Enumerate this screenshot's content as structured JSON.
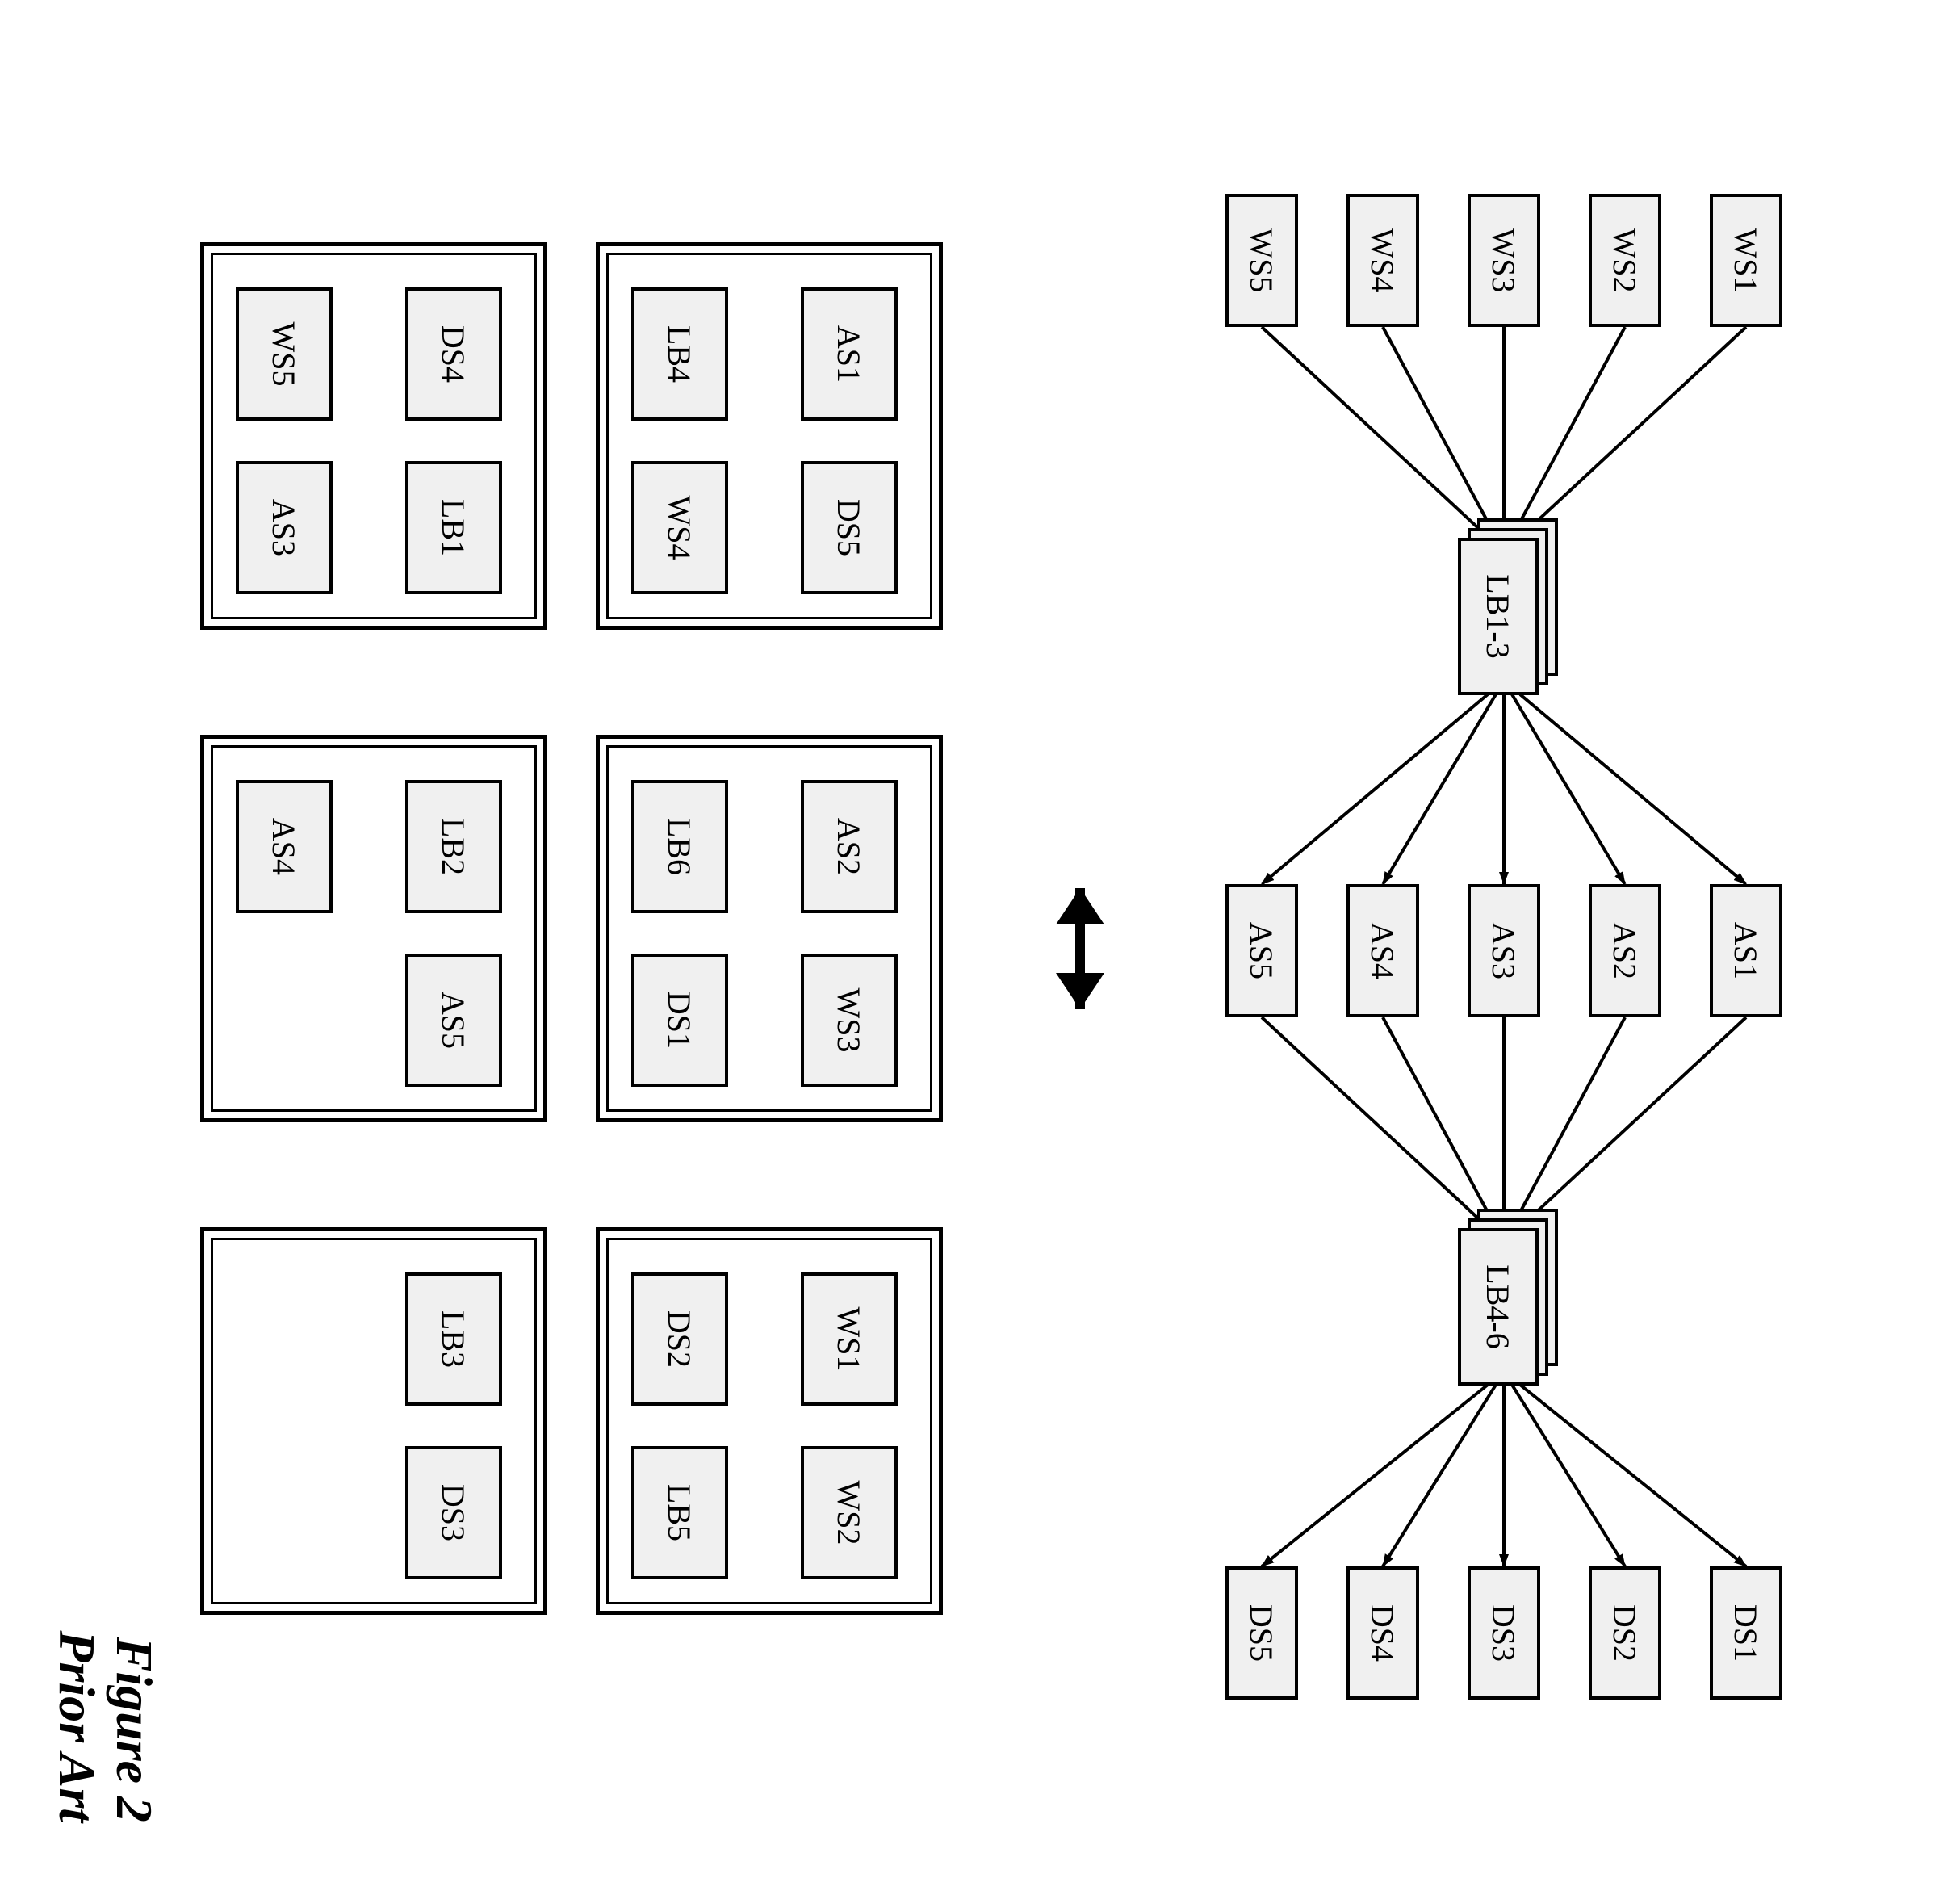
{
  "figure": {
    "number_label": "Figure 2",
    "subtitle": "Prior Art"
  },
  "network": {
    "ws": [
      "WS1",
      "WS2",
      "WS3",
      "WS4",
      "WS5"
    ],
    "lb_first": "LB1-3",
    "as": [
      "AS1",
      "AS2",
      "AS3",
      "AS4",
      "AS5"
    ],
    "lb_second": "LB4-6",
    "ds": [
      "DS1",
      "DS2",
      "DS3",
      "DS4",
      "DS5"
    ]
  },
  "hosts": [
    {
      "slots": [
        "AS1",
        "DS5",
        "LB4",
        "WS4"
      ]
    },
    {
      "slots": [
        "AS2",
        "WS3",
        "LB6",
        "DS1"
      ]
    },
    {
      "slots": [
        "WS1",
        "WS2",
        "DS2",
        "LB5"
      ]
    },
    {
      "slots": [
        "DS4",
        "LB1",
        "WS5",
        "AS3"
      ]
    },
    {
      "slots": [
        "LB2",
        "AS5",
        "AS4",
        ""
      ]
    },
    {
      "slots": [
        "LB3",
        "DS3",
        "",
        ""
      ]
    }
  ]
}
